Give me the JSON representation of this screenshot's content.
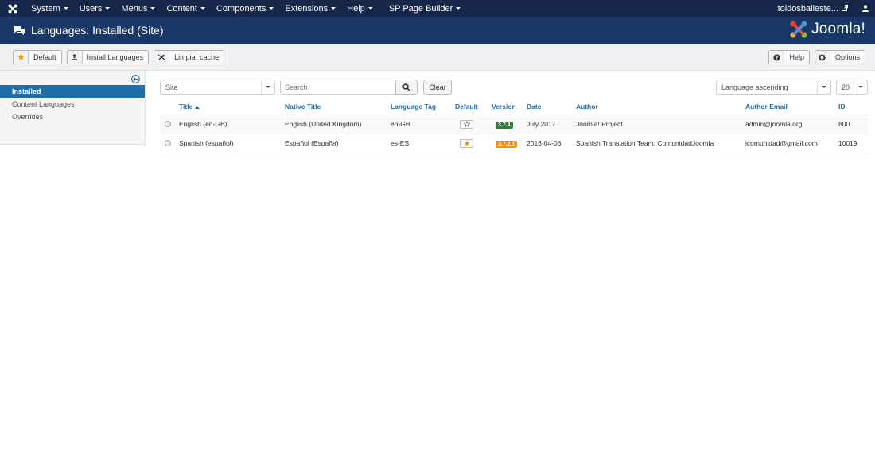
{
  "navbar": {
    "menus": [
      "System",
      "Users",
      "Menus",
      "Content",
      "Components",
      "Extensions",
      "Help"
    ],
    "extra_menu": "SP Page Builder",
    "site_name": "toldosballeste..."
  },
  "header": {
    "title": "Languages: Installed (Site)",
    "brand": "Joomla!"
  },
  "toolbar": {
    "default_label": "Default",
    "install_label": "Install Languages",
    "cache_label": "Limpiar cache",
    "help_label": "Help",
    "options_label": "Options"
  },
  "sidebar": {
    "items": [
      "Installed",
      "Content Languages",
      "Overrides"
    ]
  },
  "filters": {
    "client_value": "Site",
    "search_placeholder": "Search",
    "clear_label": "Clear",
    "ordering_value": "Language ascending",
    "limit_value": "20"
  },
  "table": {
    "headers": {
      "title": "Title",
      "native": "Native Title",
      "tag": "Language Tag",
      "default": "Default",
      "version": "Version",
      "date": "Date",
      "author": "Author",
      "email": "Author Email",
      "id": "ID"
    },
    "rows": [
      {
        "title": "English (en-GB)",
        "native": "English (United Kingdom)",
        "tag": "en-GB",
        "version": "3.7.4",
        "date": "July 2017",
        "author": "Joomla! Project",
        "email": "admin@joomla.org",
        "id": "600"
      },
      {
        "title": "Spanish (español)",
        "native": "Español (España)",
        "tag": "es-ES",
        "version": "3.7.2.1",
        "date": "2016-04-06",
        "author": "Spanish Translation Team: ComunidadJoomla",
        "email": "jcomunidad@gmail.com",
        "id": "10019"
      }
    ]
  },
  "colors": {
    "navbar": "#17274a",
    "header": "#1a3867",
    "accent": "#1f6ea6",
    "badge_green": "#2d7d32",
    "badge_orange": "#f0920a",
    "star": "#f0920a"
  }
}
